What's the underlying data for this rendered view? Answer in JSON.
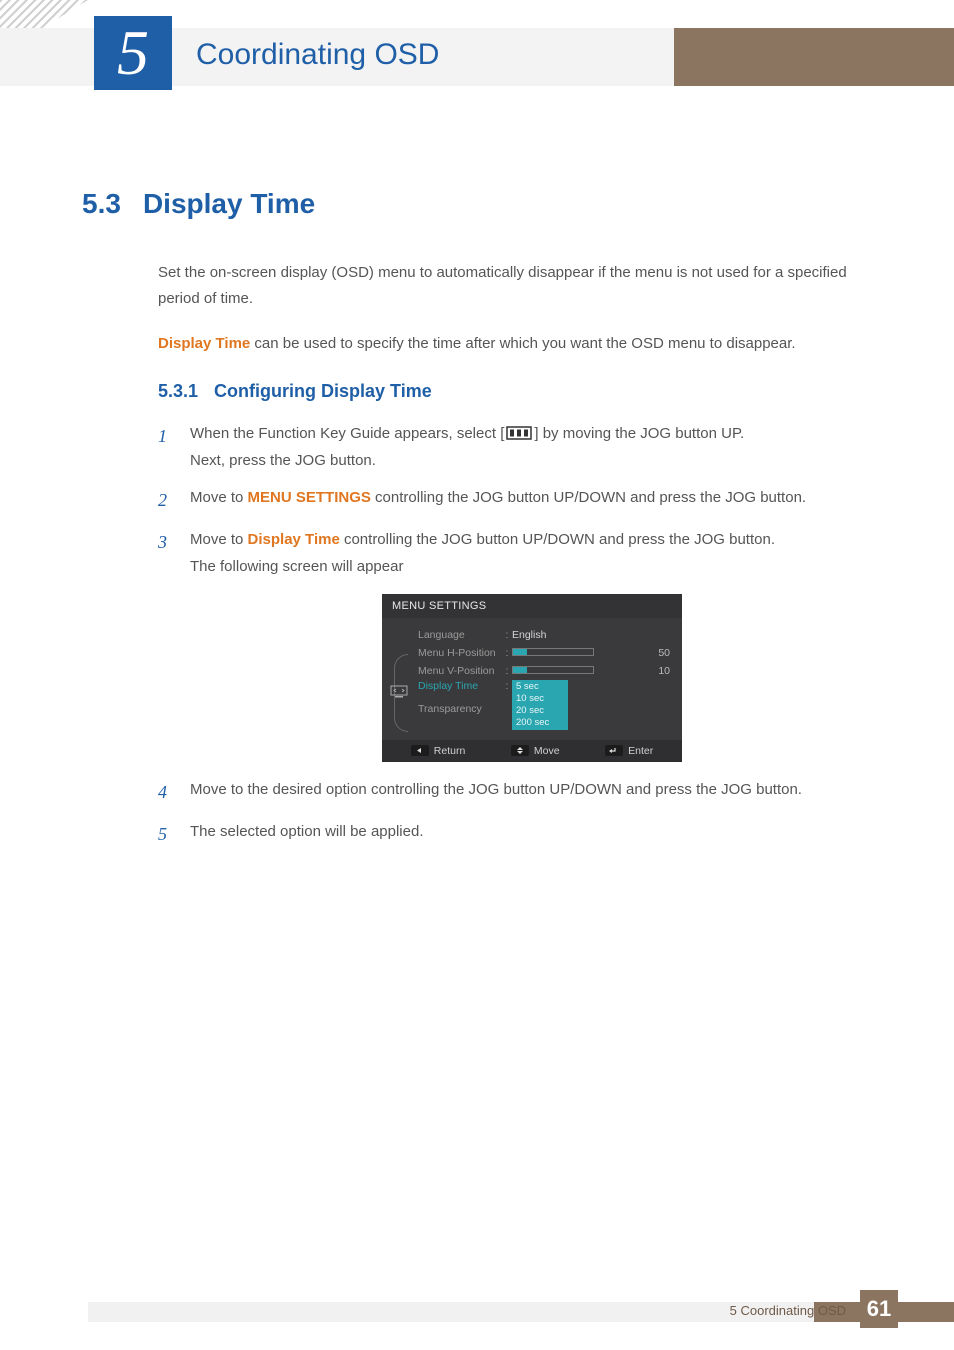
{
  "chapter": {
    "number": "5",
    "title": "Coordinating OSD"
  },
  "section": {
    "number": "5.3",
    "title": "Display Time"
  },
  "para_intro": "Set the on-screen display (OSD) menu to automatically disappear if the menu is not used for a specified period of time.",
  "para2_term": "Display Time",
  "para2_rest": " can be used to specify the time after which you want the OSD menu to disappear.",
  "subsection": {
    "number": "5.3.1",
    "title": "Configuring Display Time"
  },
  "steps": {
    "s1_a": "When the Function Key Guide appears, select ",
    "s1_b": " by moving the JOG button UP.",
    "s1_c": "Next, press the JOG button.",
    "s2_a": "Move to ",
    "s2_hl": "MENU SETTINGS",
    "s2_b": " controlling the JOG button UP/DOWN and press the JOG button.",
    "s3_a": "Move to ",
    "s3_hl": "Display Time",
    "s3_b": " controlling the JOG button UP/DOWN and press the JOG button.",
    "s3_c": "The following screen will appear",
    "s4": "Move to the desired option controlling the JOG button UP/DOWN and press the JOG button.",
    "s5": "The selected option will be applied."
  },
  "step_numbers": {
    "n1": "1",
    "n2": "2",
    "n3": "3",
    "n4": "4",
    "n5": "5"
  },
  "osd": {
    "header": "MENU SETTINGS",
    "rows": {
      "language": {
        "label": "Language",
        "value": "English"
      },
      "hpos": {
        "label": "Menu H-Position",
        "value": "50"
      },
      "vpos": {
        "label": "Menu V-Position",
        "value": "10"
      },
      "dtime": {
        "label": "Display Time",
        "options": [
          "5 sec",
          "10 sec",
          "20 sec",
          "200 sec"
        ]
      },
      "transp": {
        "label": "Transparency"
      }
    },
    "footer": {
      "return": "Return",
      "move": "Move",
      "enter": "Enter"
    }
  },
  "footer": {
    "text": "5 Coordinating OSD",
    "page": "61"
  },
  "colors": {
    "blue": "#1f5fa7",
    "orange": "#e07720",
    "brown": "#8b7561",
    "teal": "#2aa6b0"
  }
}
